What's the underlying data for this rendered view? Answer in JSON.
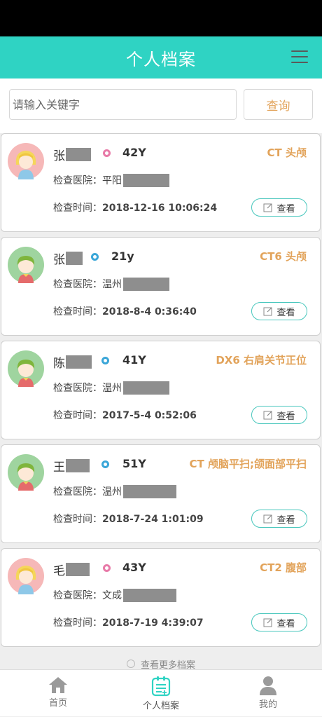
{
  "header": {
    "title": "个人档案"
  },
  "search": {
    "placeholder": "请输入关键字",
    "button_label": "查询"
  },
  "records": [
    {
      "surname": "张",
      "gender": "female",
      "age": "42Y",
      "exam": "CT 头颅",
      "hospital_label": "检查医院：",
      "hospital": "平阳",
      "time_label": "检查时间：",
      "time": "2018-12-16 10:06:24",
      "view_label": "查看"
    },
    {
      "surname": "张",
      "gender": "male",
      "age": "21y",
      "exam": "CT6 头颅",
      "hospital_label": "检查医院：",
      "hospital": "温州",
      "time_label": "检查时间：",
      "time": "2018-8-4 0:36:40",
      "view_label": "查看"
    },
    {
      "surname": "陈",
      "gender": "male",
      "age": "41Y",
      "exam": "DX6 右肩关节正位",
      "hospital_label": "检查医院：",
      "hospital": "温州",
      "time_label": "检查时间：",
      "time": "2017-5-4 0:52:06",
      "view_label": "查看"
    },
    {
      "surname": "王",
      "gender": "male",
      "age": "51Y",
      "exam": "CT 颅脑平扫;颌面部平扫",
      "hospital_label": "检查医院：",
      "hospital": "温州",
      "time_label": "检查时间：",
      "time": "2018-7-24 1:01:09",
      "view_label": "查看"
    },
    {
      "surname": "毛",
      "gender": "female",
      "age": "43Y",
      "exam": "CT2 腹部",
      "hospital_label": "检查医院：",
      "hospital": "文成",
      "time_label": "检查时间：",
      "time": "2018-7-19 4:39:07",
      "view_label": "查看"
    }
  ],
  "more": {
    "label": "查看更多档案"
  },
  "tabs": [
    {
      "label": "首页",
      "icon": "home-icon"
    },
    {
      "label": "个人档案",
      "icon": "records-icon"
    },
    {
      "label": "我的",
      "icon": "user-icon"
    }
  ],
  "colors": {
    "accent": "#2fd3c3",
    "exam_text": "#e2a35a",
    "view_border": "#49c7bd",
    "female": "#e87aa8",
    "male": "#3aa6d8"
  }
}
